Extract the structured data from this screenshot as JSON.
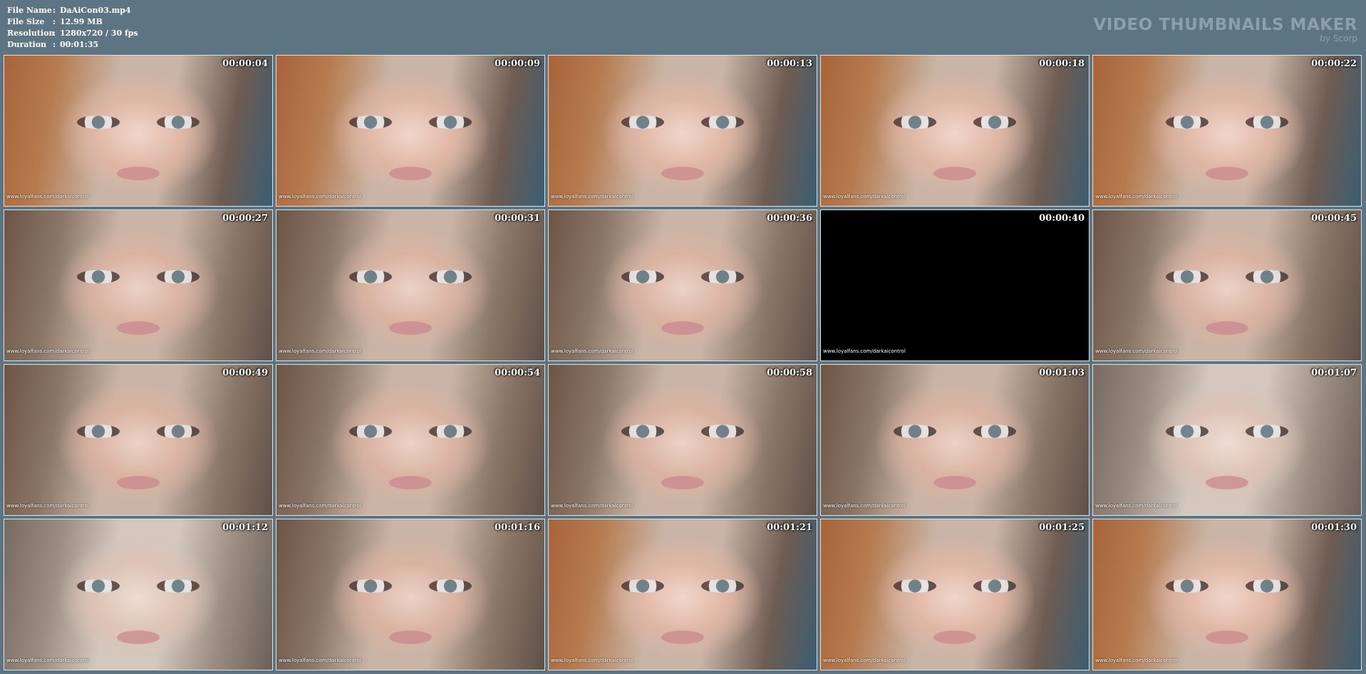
{
  "info": {
    "rows": [
      {
        "label": "File Name",
        "sep": ":",
        "value": "DaAiCon03.mp4"
      },
      {
        "label": "File Size",
        "sep": ":",
        "value": "12.99 MB"
      },
      {
        "label": "Resolution",
        "sep": ":",
        "value": "1280x720 / 30 fps"
      },
      {
        "label": "Duration",
        "sep": ":",
        "value": "00:01:35"
      }
    ]
  },
  "brand": {
    "title": "VIDEO THUMBNAILS MAKER",
    "subtitle": "by Scorp"
  },
  "watermark": "www.loyalfans.com/darkaicontrol",
  "thumbnails": [
    {
      "time": "00:00:04",
      "style": "warm"
    },
    {
      "time": "00:00:09",
      "style": "warm"
    },
    {
      "time": "00:00:13",
      "style": "warm"
    },
    {
      "time": "00:00:18",
      "style": "warm"
    },
    {
      "time": "00:00:22",
      "style": "warm"
    },
    {
      "time": "00:00:27",
      "style": "normal"
    },
    {
      "time": "00:00:31",
      "style": "normal"
    },
    {
      "time": "00:00:36",
      "style": "normal"
    },
    {
      "time": "00:00:40",
      "style": "black"
    },
    {
      "time": "00:00:45",
      "style": "normal"
    },
    {
      "time": "00:00:49",
      "style": "normal"
    },
    {
      "time": "00:00:54",
      "style": "normal"
    },
    {
      "time": "00:00:58",
      "style": "normal"
    },
    {
      "time": "00:01:03",
      "style": "normal"
    },
    {
      "time": "00:01:07",
      "style": "pale"
    },
    {
      "time": "00:01:12",
      "style": "pale"
    },
    {
      "time": "00:01:16",
      "style": "normal"
    },
    {
      "time": "00:01:21",
      "style": "warm"
    },
    {
      "time": "00:01:25",
      "style": "warm"
    },
    {
      "time": "00:01:30",
      "style": "warm"
    }
  ]
}
